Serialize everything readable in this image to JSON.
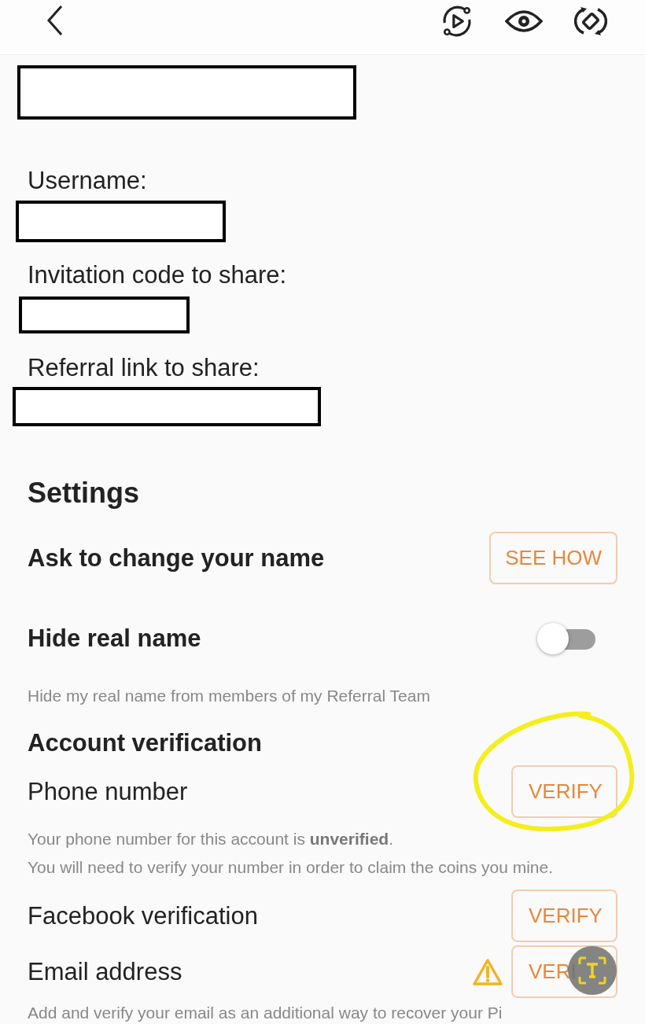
{
  "profile": {
    "fields": [
      {
        "label": "Username:"
      },
      {
        "label": "Invitation code to share:"
      },
      {
        "label": "Referral link to share:"
      }
    ]
  },
  "settings": {
    "title": "Settings",
    "rows": [
      {
        "kind": "button",
        "label": "Ask to change your name",
        "button": "SEE HOW"
      },
      {
        "kind": "toggle",
        "label": "Hide real name",
        "on": false,
        "caption": "Hide my real name from members of my Referral Team"
      }
    ]
  },
  "verification": {
    "title": "Account verification",
    "rows": [
      {
        "label": "Phone number",
        "button": "VERIFY",
        "warning": false,
        "captions": [
          "Your phone number for this account is **unverified**.",
          "You will need to verify your number in order to claim the coins you mine."
        ]
      },
      {
        "label": "Facebook verification",
        "button": "VERIFY",
        "warning": false
      },
      {
        "label": "Email address",
        "button": "VERI",
        "warning": true,
        "captions": [
          "Add and verify your email as an additional way to recover your Pi"
        ]
      }
    ]
  }
}
